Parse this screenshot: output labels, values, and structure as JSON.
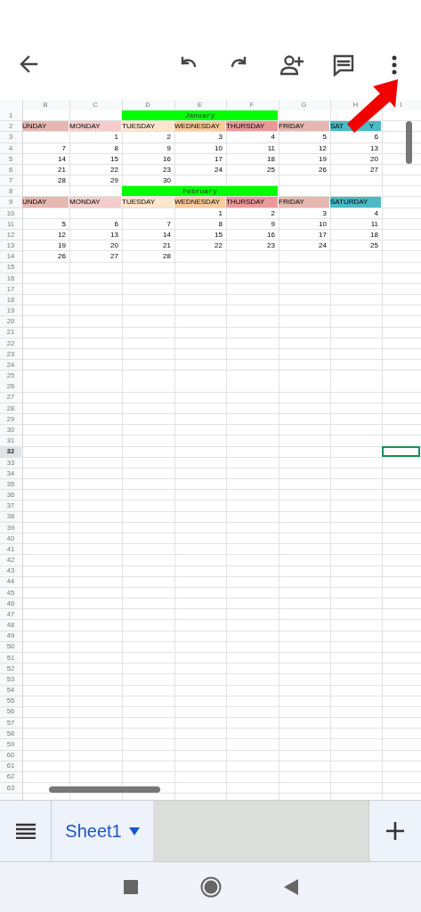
{
  "toolbar": {
    "buttons": [
      {
        "kind": "back"
      },
      {
        "kind": "undo"
      },
      {
        "kind": "redo"
      },
      {
        "kind": "share"
      },
      {
        "kind": "comment"
      },
      {
        "kind": "more"
      }
    ],
    "annotation": {
      "kind": "arrow"
    }
  },
  "sheet": {
    "columns": [
      "B",
      "C",
      "D",
      "E",
      "F",
      "G",
      "H",
      "I"
    ],
    "rows": [
      {
        "number": "1",
        "kind": "month",
        "title": "January",
        "selected": false
      },
      {
        "number": "2",
        "kind": "weekdays",
        "selected": false,
        "days": [
          {
            "label": "UNDAY",
            "color": "#e6b8af"
          },
          {
            "label": "MONDAY",
            "color": "#f4cccc"
          },
          {
            "label": "TUESDAY",
            "color": "#fce5cd"
          },
          {
            "label": "WEDNESDAY",
            "color": "#f9cb9c"
          },
          {
            "label": "THURSDAY",
            "color": "#ea9999"
          },
          {
            "label": "FRIDAY",
            "color": "#e6b8af"
          },
          {
            "label": "SAT",
            "label_end": "Y",
            "color": "#4bbac4"
          }
        ]
      },
      {
        "number": "3",
        "kind": "dates",
        "selected": false,
        "cells": [
          {
            "kind": "empty"
          },
          {
            "kind": "date",
            "text": "1"
          },
          {
            "kind": "date",
            "text": "2"
          },
          {
            "kind": "date",
            "text": "3"
          },
          {
            "kind": "date",
            "text": "4"
          },
          {
            "kind": "date",
            "text": "5"
          },
          {
            "kind": "date",
            "text": "6"
          }
        ]
      },
      {
        "number": "4",
        "kind": "dates",
        "selected": false,
        "cells": [
          {
            "kind": "date",
            "text": "7"
          },
          {
            "kind": "date",
            "text": "8"
          },
          {
            "kind": "date",
            "text": "9"
          },
          {
            "kind": "date",
            "text": "10"
          },
          {
            "kind": "date",
            "text": "11"
          },
          {
            "kind": "date",
            "text": "12"
          },
          {
            "kind": "date",
            "text": "13"
          }
        ]
      },
      {
        "number": "5",
        "kind": "dates",
        "selected": false,
        "cells": [
          {
            "kind": "date",
            "text": "14"
          },
          {
            "kind": "date",
            "text": "15"
          },
          {
            "kind": "date",
            "text": "16"
          },
          {
            "kind": "date",
            "text": "17"
          },
          {
            "kind": "date",
            "text": "18"
          },
          {
            "kind": "date",
            "text": "19"
          },
          {
            "kind": "date",
            "text": "20"
          }
        ]
      },
      {
        "number": "6",
        "kind": "dates",
        "selected": false,
        "cells": [
          {
            "kind": "date",
            "text": "21"
          },
          {
            "kind": "date",
            "text": "22"
          },
          {
            "kind": "date",
            "text": "23"
          },
          {
            "kind": "date",
            "text": "24"
          },
          {
            "kind": "date",
            "text": "25"
          },
          {
            "kind": "date",
            "text": "26"
          },
          {
            "kind": "date",
            "text": "27"
          }
        ]
      },
      {
        "number": "7",
        "kind": "dates",
        "selected": false,
        "cells": [
          {
            "kind": "date",
            "text": "28"
          },
          {
            "kind": "date",
            "text": "29"
          },
          {
            "kind": "date",
            "text": "30"
          }
        ]
      },
      {
        "number": "8",
        "kind": "month",
        "title": "February",
        "selected": false
      },
      {
        "number": "9",
        "kind": "weekdays",
        "selected": false,
        "days": [
          {
            "label": "UNDAY",
            "color": "#e6b8af"
          },
          {
            "label": "MONDAY",
            "color": "#f4cccc"
          },
          {
            "label": "TUESDAY",
            "color": "#fce5cd"
          },
          {
            "label": "WEDNESDAY",
            "color": "#f9cb9c"
          },
          {
            "label": "THURSDAY",
            "color": "#ea9999"
          },
          {
            "label": "FRIDAY",
            "color": "#e6b8af"
          },
          {
            "label": "SATURDAY",
            "color": "#4bbac4"
          }
        ]
      },
      {
        "number": "10",
        "kind": "dates",
        "selected": false,
        "cells": [
          {
            "kind": "empty"
          },
          {
            "kind": "empty"
          },
          {
            "kind": "empty"
          },
          {
            "kind": "date",
            "text": "1"
          },
          {
            "kind": "date",
            "text": "2"
          },
          {
            "kind": "date",
            "text": "3"
          },
          {
            "kind": "date",
            "text": "4"
          }
        ]
      },
      {
        "number": "11",
        "kind": "dates",
        "selected": false,
        "cells": [
          {
            "kind": "date",
            "text": "5"
          },
          {
            "kind": "date",
            "text": "6"
          },
          {
            "kind": "date",
            "text": "7"
          },
          {
            "kind": "date",
            "text": "8"
          },
          {
            "kind": "date",
            "text": "9"
          },
          {
            "kind": "date",
            "text": "10"
          },
          {
            "kind": "date",
            "text": "11"
          }
        ]
      },
      {
        "number": "12",
        "kind": "dates",
        "selected": false,
        "cells": [
          {
            "kind": "date",
            "text": "12"
          },
          {
            "kind": "date",
            "text": "13"
          },
          {
            "kind": "date",
            "text": "14"
          },
          {
            "kind": "date",
            "text": "15"
          },
          {
            "kind": "date",
            "text": "16"
          },
          {
            "kind": "date",
            "text": "17"
          },
          {
            "kind": "date",
            "text": "18"
          }
        ]
      },
      {
        "number": "13",
        "kind": "dates",
        "selected": false,
        "cells": [
          {
            "kind": "date",
            "text": "19"
          },
          {
            "kind": "date",
            "text": "20"
          },
          {
            "kind": "date",
            "text": "21"
          },
          {
            "kind": "date",
            "text": "22"
          },
          {
            "kind": "date",
            "text": "23"
          },
          {
            "kind": "date",
            "text": "24"
          },
          {
            "kind": "date",
            "text": "25"
          }
        ]
      },
      {
        "number": "14",
        "kind": "dates",
        "selected": false,
        "cells": [
          {
            "kind": "date",
            "text": "26"
          },
          {
            "kind": "date",
            "text": "27"
          },
          {
            "kind": "date",
            "text": "28"
          }
        ]
      },
      {
        "number": "15",
        "kind": "blank",
        "selected": false
      },
      {
        "number": "16",
        "kind": "blank",
        "selected": false
      },
      {
        "number": "17",
        "kind": "blank",
        "selected": false
      },
      {
        "number": "18",
        "kind": "blank",
        "selected": false
      },
      {
        "number": "19",
        "kind": "blank",
        "selected": false
      },
      {
        "number": "20",
        "kind": "blank",
        "selected": false
      },
      {
        "number": "21",
        "kind": "blank",
        "selected": false
      },
      {
        "number": "22",
        "kind": "blank",
        "selected": false
      },
      {
        "number": "23",
        "kind": "blank",
        "selected": false
      },
      {
        "number": "24",
        "kind": "blank",
        "selected": false
      },
      {
        "number": "25",
        "kind": "blank",
        "selected": false
      },
      {
        "number": "26",
        "kind": "blank",
        "selected": false
      },
      {
        "number": "27",
        "kind": "blank",
        "selected": false
      },
      {
        "number": "28",
        "kind": "blank",
        "selected": false
      },
      {
        "number": "29",
        "kind": "blank",
        "selected": false
      },
      {
        "number": "30",
        "kind": "blank",
        "selected": false
      },
      {
        "number": "31",
        "kind": "blank",
        "selected": false
      },
      {
        "number": "32",
        "kind": "blank",
        "selected": true
      },
      {
        "number": "33",
        "kind": "blank",
        "selected": false
      },
      {
        "number": "34",
        "kind": "blank",
        "selected": false
      },
      {
        "number": "35",
        "kind": "blank",
        "selected": false
      },
      {
        "number": "36",
        "kind": "blank",
        "selected": false
      },
      {
        "number": "37",
        "kind": "blank",
        "selected": false
      },
      {
        "number": "38",
        "kind": "blank",
        "selected": false
      },
      {
        "number": "39",
        "kind": "blank",
        "selected": false
      },
      {
        "number": "40",
        "kind": "blank",
        "selected": false
      },
      {
        "number": "41",
        "kind": "blank",
        "selected": false
      },
      {
        "number": "42",
        "kind": "blank",
        "selected": false
      },
      {
        "number": "43",
        "kind": "blank",
        "selected": false
      },
      {
        "number": "44",
        "kind": "blank",
        "selected": false
      },
      {
        "number": "45",
        "kind": "blank",
        "selected": false
      },
      {
        "number": "46",
        "kind": "blank",
        "selected": false
      },
      {
        "number": "47",
        "kind": "blank",
        "selected": false
      },
      {
        "number": "48",
        "kind": "blank",
        "selected": false
      },
      {
        "number": "49",
        "kind": "blank",
        "selected": false
      },
      {
        "number": "50",
        "kind": "blank",
        "selected": false
      },
      {
        "number": "51",
        "kind": "blank",
        "selected": false
      },
      {
        "number": "52",
        "kind": "blank",
        "selected": false
      },
      {
        "number": "53",
        "kind": "blank",
        "selected": false
      },
      {
        "number": "54",
        "kind": "blank",
        "selected": false
      },
      {
        "number": "55",
        "kind": "blank",
        "selected": false
      },
      {
        "number": "56",
        "kind": "blank",
        "selected": false
      },
      {
        "number": "57",
        "kind": "blank",
        "selected": false
      },
      {
        "number": "58",
        "kind": "blank",
        "selected": false
      },
      {
        "number": "59",
        "kind": "blank",
        "selected": false
      },
      {
        "number": "60",
        "kind": "blank",
        "selected": false
      },
      {
        "number": "61",
        "kind": "blank",
        "selected": false
      },
      {
        "number": "62",
        "kind": "blank",
        "selected": false
      },
      {
        "number": "63",
        "kind": "blank",
        "selected": false
      }
    ]
  },
  "sheet_tabs": [
    {
      "label": "Sheet1",
      "selected": true
    }
  ],
  "nav_bar": [
    {
      "kind": "recents"
    },
    {
      "kind": "home"
    },
    {
      "kind": "back"
    }
  ]
}
